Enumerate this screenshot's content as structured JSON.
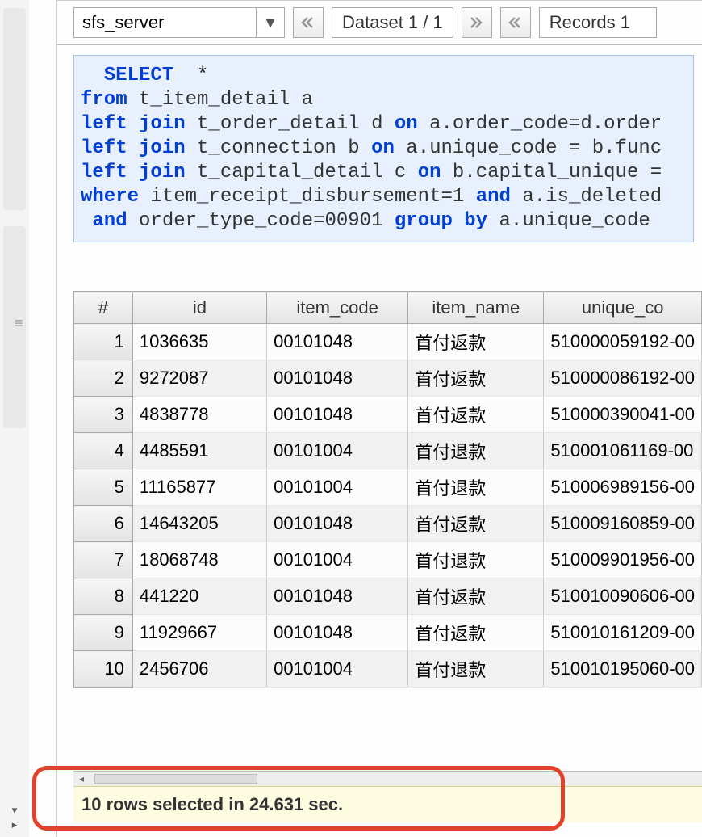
{
  "toolbar": {
    "connection": "sfs_server",
    "dataset_label": "Dataset 1 / 1",
    "records_label": "Records 1"
  },
  "sql": {
    "tokens": [
      [
        [
          "sp",
          "  "
        ],
        [
          "kw",
          "SELECT"
        ],
        [
          "sp",
          "  "
        ],
        [
          "op",
          "*"
        ]
      ],
      [
        [
          "kw",
          "from"
        ],
        [
          "sp",
          " "
        ],
        [
          "id",
          "t_item_detail a"
        ]
      ],
      [
        [
          "kw",
          "left join"
        ],
        [
          "sp",
          " "
        ],
        [
          "id",
          "t_order_detail d"
        ],
        [
          "sp",
          " "
        ],
        [
          "kw",
          "on"
        ],
        [
          "sp",
          " "
        ],
        [
          "id",
          "a.order_code=d.order"
        ]
      ],
      [
        [
          "kw",
          "left join"
        ],
        [
          "sp",
          " "
        ],
        [
          "id",
          "t_connection b"
        ],
        [
          "sp",
          " "
        ],
        [
          "kw",
          "on"
        ],
        [
          "sp",
          " "
        ],
        [
          "id",
          "a.unique_code = b.func"
        ]
      ],
      [
        [
          "kw",
          "left join"
        ],
        [
          "sp",
          " "
        ],
        [
          "id",
          "t_capital_detail c"
        ],
        [
          "sp",
          " "
        ],
        [
          "kw",
          "on"
        ],
        [
          "sp",
          " "
        ],
        [
          "id",
          "b.capital_unique ="
        ]
      ],
      [
        [
          "kw",
          "where"
        ],
        [
          "sp",
          " "
        ],
        [
          "id",
          "item_receipt_disbursement=1"
        ],
        [
          "sp",
          " "
        ],
        [
          "kw",
          "and"
        ],
        [
          "sp",
          " "
        ],
        [
          "id",
          "a.is_deleted"
        ]
      ],
      [
        [
          "sp",
          " "
        ],
        [
          "kw",
          "and"
        ],
        [
          "sp",
          " "
        ],
        [
          "id",
          "order_type_code=00901"
        ],
        [
          "sp",
          " "
        ],
        [
          "kw",
          "group by"
        ],
        [
          "sp",
          " "
        ],
        [
          "id",
          "a.unique_code"
        ]
      ]
    ]
  },
  "table": {
    "columns": [
      "#",
      "id",
      "item_code",
      "item_name",
      "unique_co"
    ],
    "rows": [
      {
        "n": "1",
        "id": "1036635",
        "item_code": "00101048",
        "item_name": "首付返款",
        "unique": "510000059192-00"
      },
      {
        "n": "2",
        "id": "9272087",
        "item_code": "00101048",
        "item_name": "首付返款",
        "unique": "510000086192-00"
      },
      {
        "n": "3",
        "id": "4838778",
        "item_code": "00101048",
        "item_name": "首付返款",
        "unique": "510000390041-00"
      },
      {
        "n": "4",
        "id": "4485591",
        "item_code": "00101004",
        "item_name": "首付退款",
        "unique": "510001061169-00"
      },
      {
        "n": "5",
        "id": "11165877",
        "item_code": "00101004",
        "item_name": "首付退款",
        "unique": "510006989156-00"
      },
      {
        "n": "6",
        "id": "14643205",
        "item_code": "00101048",
        "item_name": "首付返款",
        "unique": "510009160859-00"
      },
      {
        "n": "7",
        "id": "18068748",
        "item_code": "00101004",
        "item_name": "首付退款",
        "unique": "510009901956-00"
      },
      {
        "n": "8",
        "id": "441220",
        "item_code": "00101048",
        "item_name": "首付返款",
        "unique": "510010090606-00"
      },
      {
        "n": "9",
        "id": "11929667",
        "item_code": "00101048",
        "item_name": "首付返款",
        "unique": "510010161209-00"
      },
      {
        "n": "10",
        "id": "2456706",
        "item_code": "00101004",
        "item_name": "首付退款",
        "unique": "510010195060-00"
      }
    ]
  },
  "status": {
    "text": "10 rows selected in 24.631 sec."
  }
}
